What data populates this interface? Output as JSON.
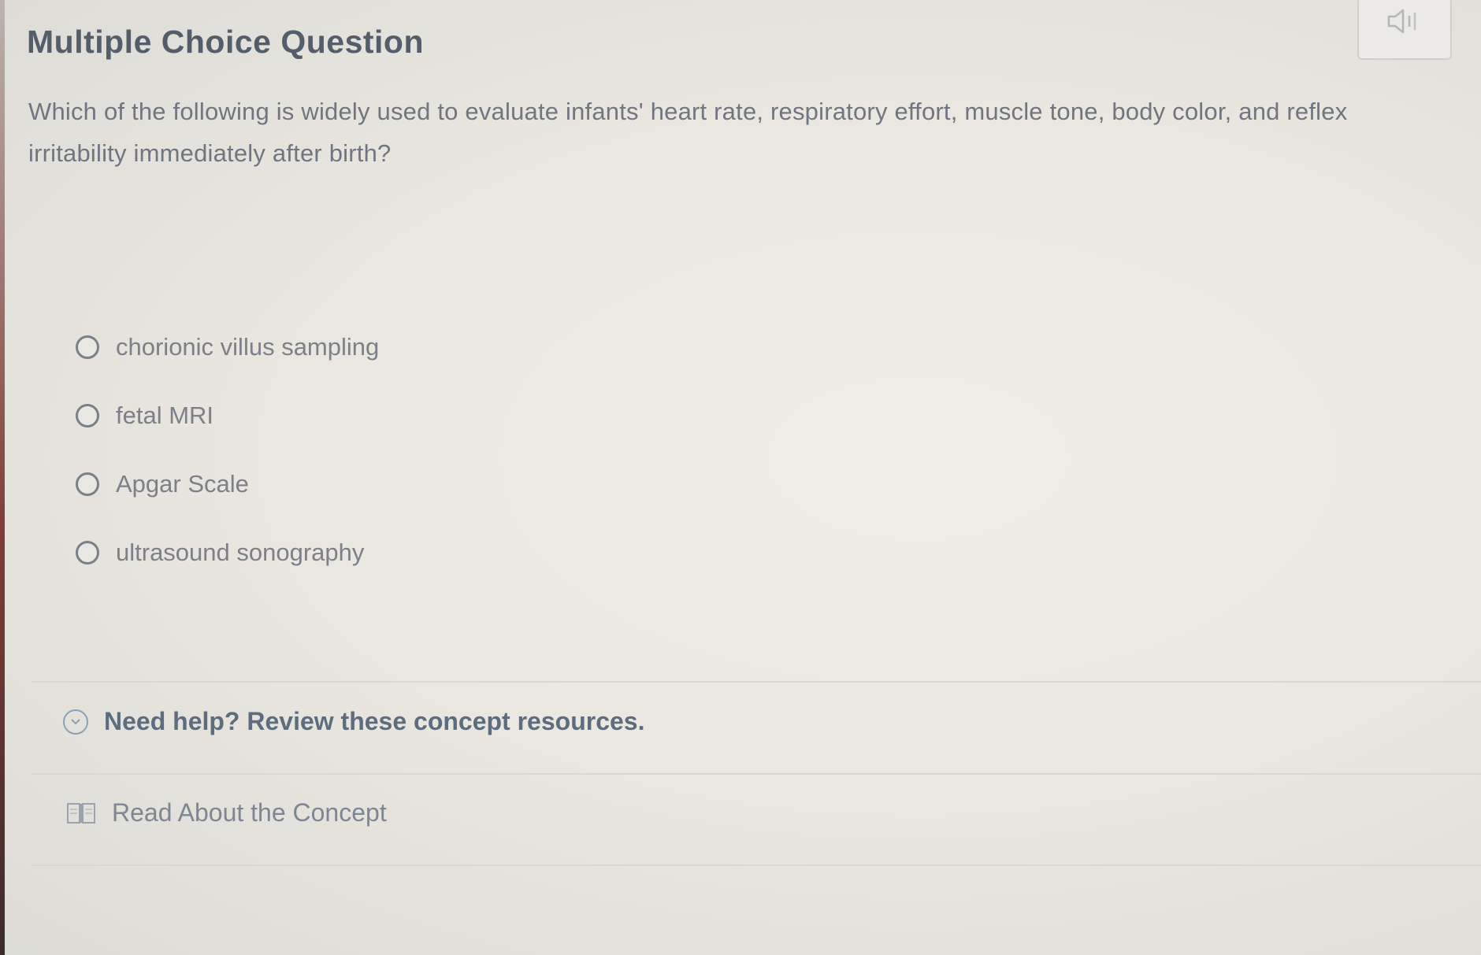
{
  "question": {
    "title": "Multiple Choice Question",
    "prompt": "Which of the following is widely used to evaluate infants' heart rate, respiratory effort, muscle tone, body color, and reflex irritability immediately after birth?",
    "choices": [
      {
        "label": "chorionic villus sampling"
      },
      {
        "label": "fetal MRI"
      },
      {
        "label": "Apgar Scale"
      },
      {
        "label": "ultrasound sonography"
      }
    ]
  },
  "help": {
    "toggle_label": "Need help? Review these concept resources.",
    "resources": [
      {
        "label": "Read About the Concept",
        "icon": "book-icon"
      }
    ]
  },
  "toolbar": {
    "audio_icon": "speaker-icon"
  }
}
